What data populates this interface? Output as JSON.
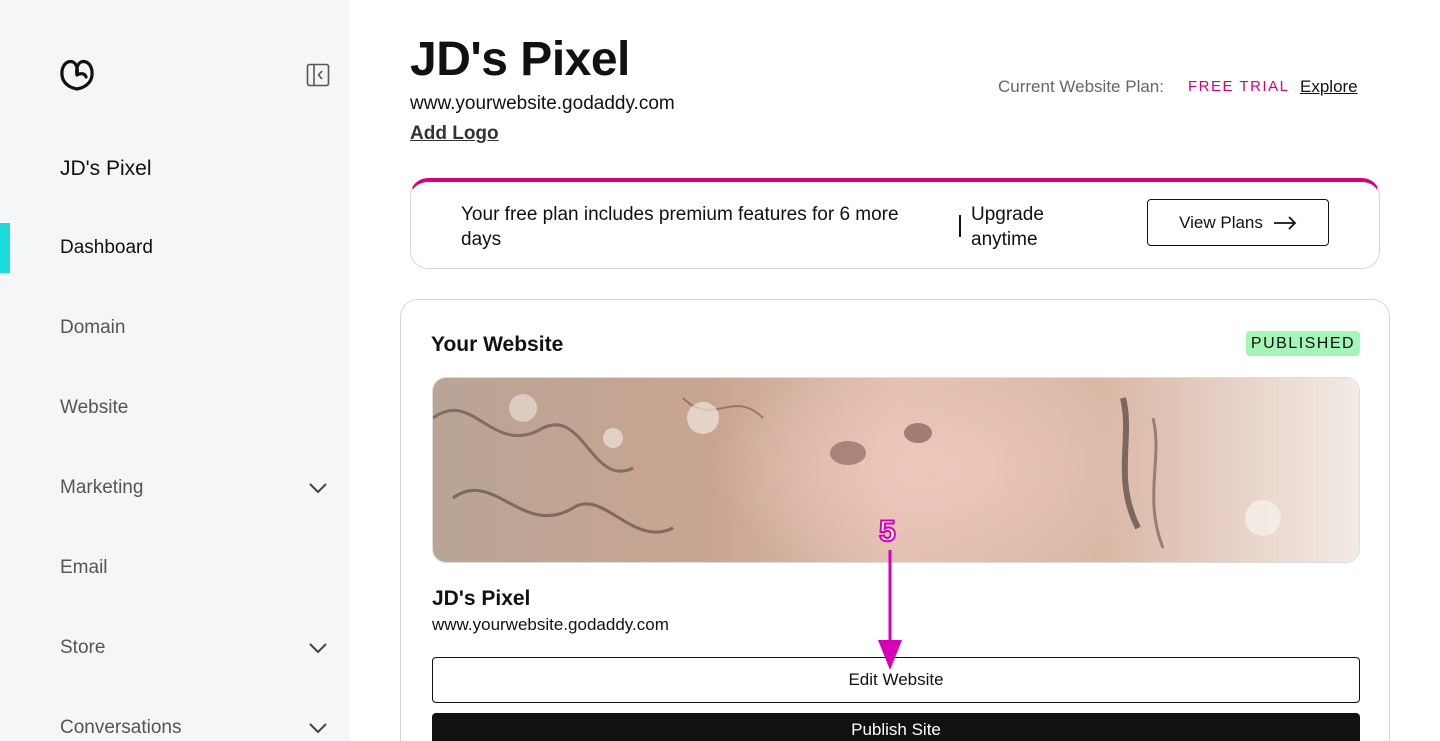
{
  "sidebar": {
    "site_name": "JD's Pixel",
    "nav": [
      {
        "label": "Dashboard"
      },
      {
        "label": "Domain"
      },
      {
        "label": "Website"
      },
      {
        "label": "Marketing"
      },
      {
        "label": "Email"
      },
      {
        "label": "Store"
      },
      {
        "label": "Conversations"
      }
    ],
    "active_indicator_color": "#1bdbdb"
  },
  "header": {
    "title": "JD's Pixel",
    "domain": "www.yourwebsite.godaddy.com",
    "add_logo": "Add Logo",
    "plan_label": "Current Website Plan:",
    "plan_value": "FREE TRIAL",
    "explore": "Explore"
  },
  "banner": {
    "text": "Your free plan includes premium features for 6 more days",
    "upgrade": "Upgrade anytime",
    "button": "View Plans",
    "accent_color": "#d6007d"
  },
  "card": {
    "title": "Your Website",
    "status": "PUBLISHED",
    "site_name": "JD's Pixel",
    "domain": "www.yourwebsite.godaddy.com",
    "edit_button": "Edit Website",
    "publish_button": "Publish Site",
    "status_color": "#a6f5b8"
  },
  "annotation": {
    "step": "5",
    "color": "#d600b8"
  }
}
